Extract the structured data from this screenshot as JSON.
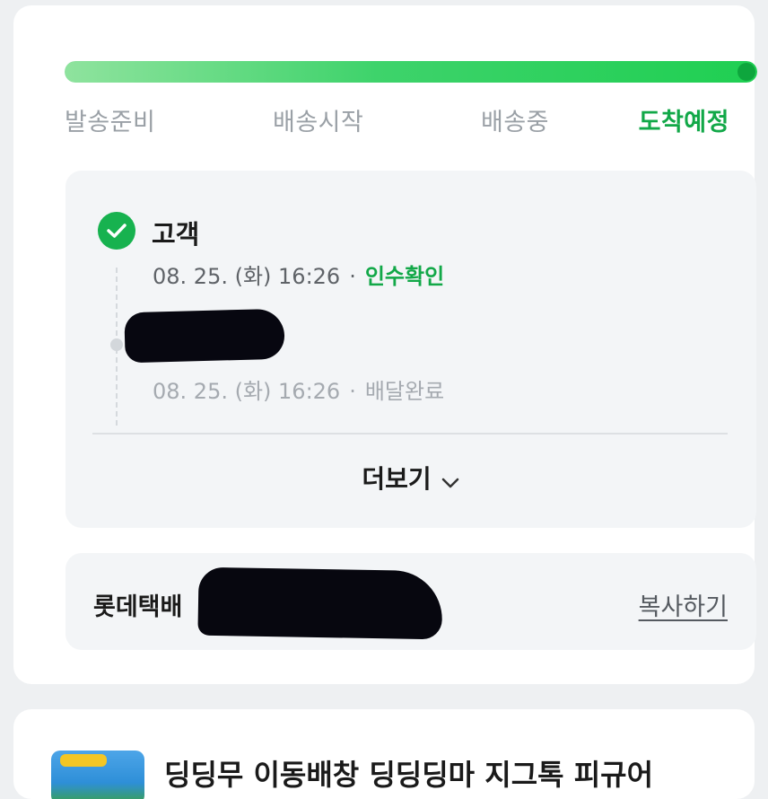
{
  "progress": {
    "value_percent": 100,
    "color": "#1fcf52",
    "steps": [
      "발송준비",
      "배송시작",
      "배송중",
      "도착예정"
    ],
    "active_index": 3
  },
  "tracking": {
    "events": [
      {
        "title": "고객",
        "date": "08. 25. (화) 16:26",
        "separator": "·",
        "status": "인수확인",
        "status_color": "#12a848"
      },
      {
        "date": "08. 25. (화) 16:26",
        "separator": "·",
        "status": "배달완료"
      }
    ],
    "more_label": "더보기",
    "more_icon": "chevron-down-icon"
  },
  "courier": {
    "name": "롯데택배",
    "copy_label": "복사하기"
  },
  "listing": {
    "title": "딩딩무 이동배창 딩딩딩마 지그톡 피규어"
  }
}
